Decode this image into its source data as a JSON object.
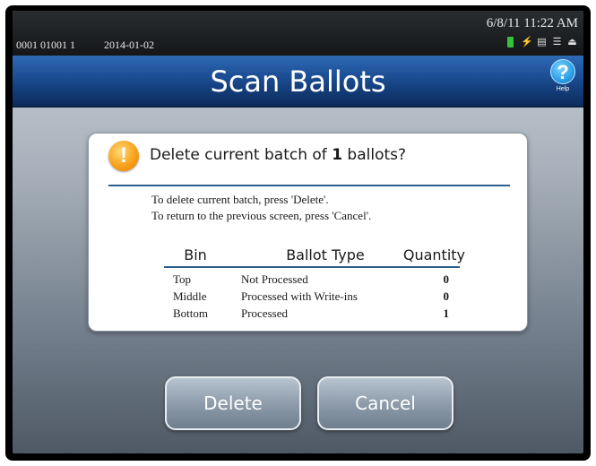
{
  "status": {
    "id": "0001 01001 1",
    "date": "2014-01-02",
    "datetime": "6/8/11   11:22 AM",
    "icons": [
      "battery-icon",
      "plug-icon",
      "document-icon",
      "network-icon",
      "lock-icon"
    ]
  },
  "header": {
    "title": "Scan Ballots",
    "help_label": "Help",
    "help_glyph": "?"
  },
  "dialog": {
    "title_prefix": "Delete current batch of ",
    "title_count": "1",
    "title_suffix": " ballots?",
    "instruction_1": "To delete current batch, press 'Delete'.",
    "instruction_2": "To return to the previous screen, press 'Cancel'.",
    "warning_glyph": "!",
    "table": {
      "headers": [
        "Bin",
        "Ballot Type",
        "Quantity"
      ],
      "rows": [
        {
          "bin": "Top",
          "type": "Not Processed",
          "qty": "0"
        },
        {
          "bin": "Middle",
          "type": "Processed with Write-ins",
          "qty": "0"
        },
        {
          "bin": "Bottom",
          "type": "Processed",
          "qty": "1"
        }
      ]
    }
  },
  "buttons": {
    "delete": "Delete",
    "cancel": "Cancel"
  },
  "colors": {
    "title_bar": "#1d4f96",
    "accent_rule": "#2f5e91",
    "warning": "#f7a21a",
    "battery": "#35c13c"
  }
}
